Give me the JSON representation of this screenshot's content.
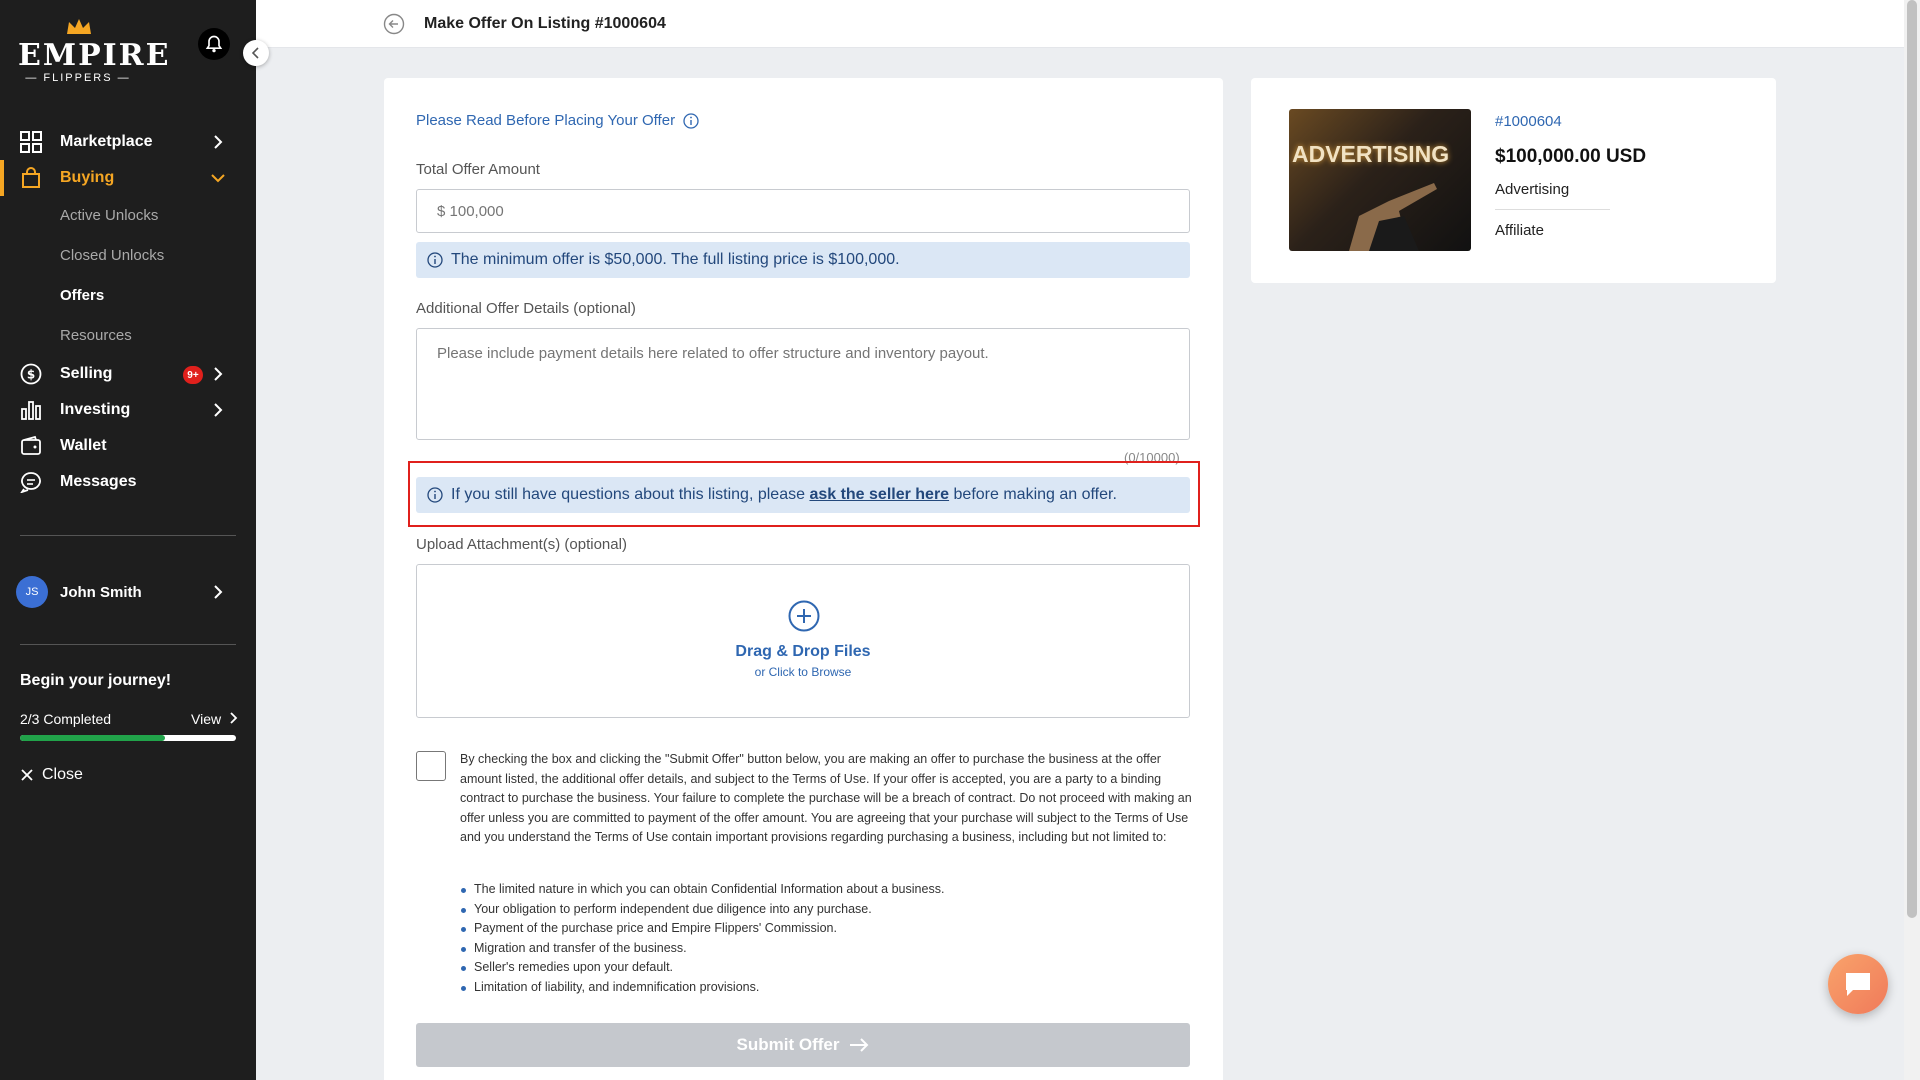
{
  "brand": {
    "name": "EMPIRE",
    "sub": "— FLIPPERS —"
  },
  "nav": {
    "marketplace": "Marketplace",
    "buying": "Buying",
    "buying_sub": [
      "Active Unlocks",
      "Closed Unlocks",
      "Offers",
      "Resources"
    ],
    "selling": "Selling",
    "selling_badge": "9+",
    "investing": "Investing",
    "wallet": "Wallet",
    "messages": "Messages"
  },
  "user": {
    "initials": "JS",
    "name": "John Smith"
  },
  "journey": {
    "title": "Begin your journey!",
    "progress_text": "2/3 Completed",
    "view": "View",
    "progress_fraction": 0.67,
    "close": "Close"
  },
  "header": {
    "title": "Make Offer On Listing #1000604"
  },
  "form": {
    "read_link": "Please Read Before Placing Your Offer",
    "total_label": "Total Offer Amount",
    "total_placeholder": "$ 100,000",
    "min_offer_prefix": "The minimum offer is ",
    "min_offer_value": "$50,000",
    "min_offer_mid": ". The full listing price is ",
    "full_price_value": "$100,000",
    "min_offer_suffix": ".",
    "details_label": "Additional Offer Details (optional)",
    "details_placeholder": "Please include payment details here related to offer structure and inventory payout.",
    "char_count": "(0/10000)",
    "questions_prefix": "If you still have questions about this listing, please ",
    "questions_link": "ask the seller here",
    "questions_suffix": " before making an offer.",
    "upload_label": "Upload Attachment(s) (optional)",
    "upload_title": "Drag & Drop Files",
    "upload_sub": "or Click to Browse",
    "terms_text": "By checking the box and clicking the \"Submit Offer\" button below, you are making an offer to purchase the business at the offer amount listed, the additional offer details, and subject to the Terms of Use. If your offer is accepted, you are a party to a binding contract to purchase the business. Your failure to complete the purchase will be a breach of contract. Do not proceed with making an offer unless you are committed to payment of the offer amount. You are agreeing that your purchase will subject to the Terms of Use and you understand the Terms of Use contain important provisions regarding purchasing a business, including but not limited to:",
    "terms_list": [
      "The limited nature in which you can obtain Confidential Information about a business.",
      "Your obligation to perform independent due diligence into any purchase.",
      "Payment of the purchase price and Empire Flippers' Commission.",
      "Migration and transfer of the business.",
      "Seller's remedies upon your default.",
      "Limitation of liability, and indemnification provisions."
    ],
    "submit": "Submit Offer"
  },
  "listing": {
    "id": "#1000604",
    "price": "$100,000.00 USD",
    "category": "Advertising",
    "model": "Affiliate",
    "thumb_text": "ADVERTISING"
  },
  "colors": {
    "accent": "#f5a623",
    "link": "#2f67b1",
    "info_bg": "#dbe7f5",
    "highlight": "#e0201c",
    "progress": "#21a34a"
  }
}
